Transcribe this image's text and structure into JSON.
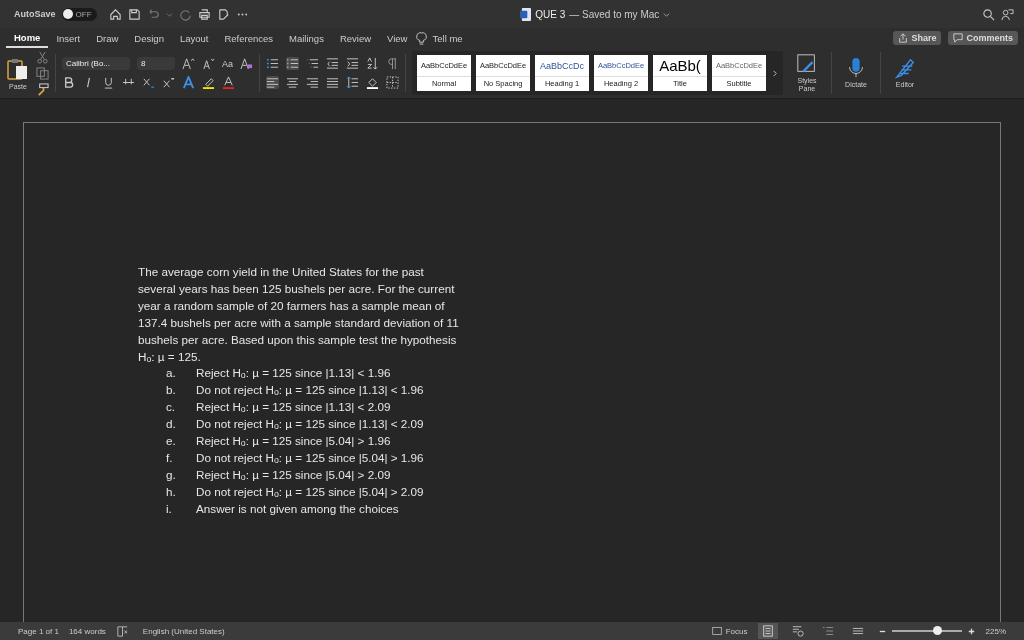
{
  "title_bar": {
    "autosave_label": "AutoSave",
    "autosave": {
      "on": false,
      "label": "OFF"
    },
    "document_title": "QUE 3",
    "save_status": "— Saved to my Mac"
  },
  "tabs": [
    {
      "label": "Home",
      "selected": true
    },
    {
      "label": "Insert",
      "selected": false
    },
    {
      "label": "Draw",
      "selected": false
    },
    {
      "label": "Design",
      "selected": false
    },
    {
      "label": "Layout",
      "selected": false
    },
    {
      "label": "References",
      "selected": false
    },
    {
      "label": "Mailings",
      "selected": false
    },
    {
      "label": "Review",
      "selected": false
    },
    {
      "label": "View",
      "selected": false
    }
  ],
  "tell_me": "Tell me",
  "share_button": "Share",
  "comments_button": "Comments",
  "ribbon": {
    "paste_label": "Paste",
    "font_name": "Calibri (Bo...",
    "font_size": "8",
    "change_case": "Aa",
    "styles": [
      {
        "preview": "AaBbCcDdEe",
        "name": "Normal",
        "kind": "normal"
      },
      {
        "preview": "AaBbCcDdEe",
        "name": "No Spacing",
        "kind": "normal"
      },
      {
        "preview": "AaBbCcDc",
        "name": "Heading 1",
        "kind": "heading1"
      },
      {
        "preview": "AaBbCcDdEe",
        "name": "Heading 2",
        "kind": "heading2"
      },
      {
        "preview": "AaBb(",
        "name": "Title",
        "kind": "title"
      },
      {
        "preview": "AaBbCcDdEe",
        "name": "Subtitle",
        "kind": "subtitle"
      }
    ],
    "styles_pane": "Styles Pane",
    "dictate": "Dictate",
    "editor": "Editor"
  },
  "document": {
    "question_lines": [
      "The average corn yield in the United States for the past",
      "several years has been 125 bushels per acre.  For the current",
      "year a random sample of 20 farmers has a sample mean of",
      "137.4 bushels per acre with a sample standard deviation of 11",
      "bushels per acre.  Based upon this sample test the hypothesis",
      "H$_{o}$: µ = 125."
    ],
    "options": [
      {
        "letter": "a.",
        "text": "Reject H$_{o}$: µ = 125 since |1.13| < 1.96"
      },
      {
        "letter": "b.",
        "text": "Do not reject H$_{o}$: µ = 125 since |1.13| < 1.96"
      },
      {
        "letter": "c.",
        "text": "Reject H$_{o}$: µ = 125 since |1.13| < 2.09"
      },
      {
        "letter": "d.",
        "text": "Do not reject H$_{o}$: µ = 125 since |1.13| < 2.09"
      },
      {
        "letter": "e.",
        "text": "Reject H$_{o}$: µ = 125 since |5.04| > 1.96"
      },
      {
        "letter": "f.",
        "text": "Do not reject H$_{o}$: µ = 125 since |5.04| > 1.96"
      },
      {
        "letter": "g.",
        "text": "Reject H$_{o}$: µ = 125 since |5.04| > 2.09"
      },
      {
        "letter": "h.",
        "text": "Do not reject H$_{o}$: µ = 125 since |5.04| > 2.09"
      },
      {
        "letter": "i.",
        "text": "Answer is not given among the choices"
      }
    ]
  },
  "status_bar": {
    "page": "Page 1 of 1",
    "words": "164 words",
    "language": "English (United States)",
    "focus": "Focus",
    "zoom": {
      "level": 0.65
    },
    "zoom_percent": "225%"
  }
}
